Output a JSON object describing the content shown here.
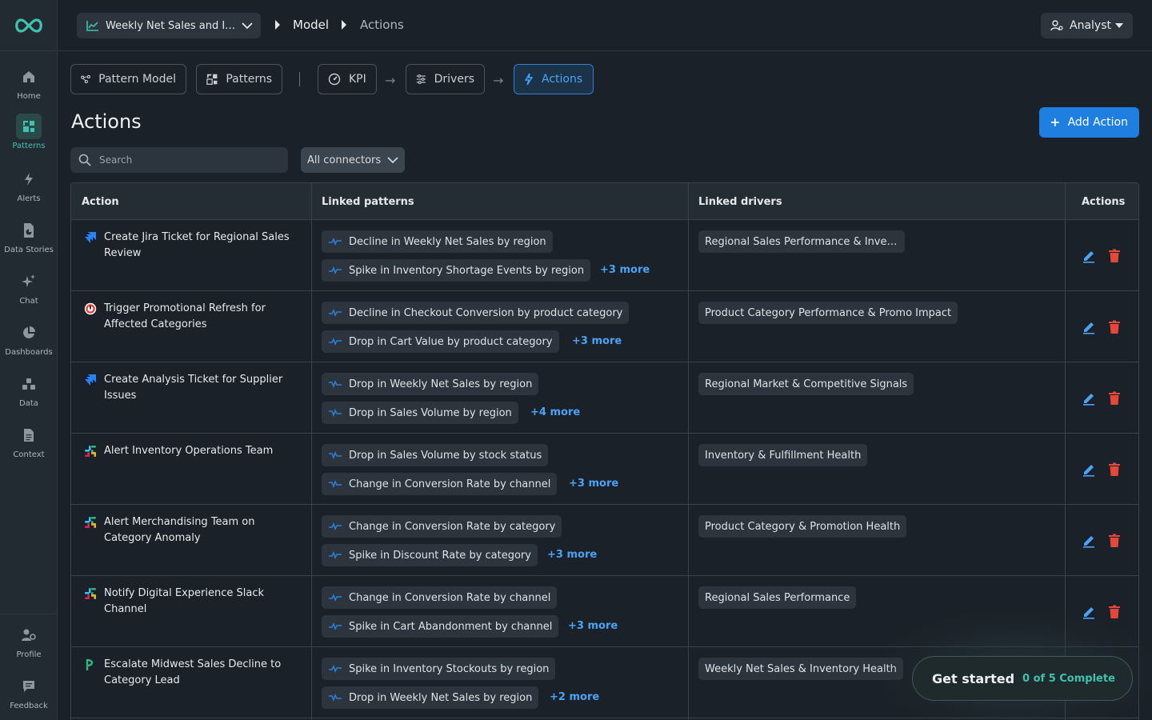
{
  "colors": {
    "accent": "#1f7fe0",
    "brand": "#3fc3b0",
    "danger": "#e5483b",
    "link": "#4aa3f5"
  },
  "sidebar": {
    "items": [
      {
        "label": "Home",
        "icon": "home-icon"
      },
      {
        "label": "Patterns",
        "icon": "patterns-icon"
      },
      {
        "label": "Alerts",
        "icon": "lightning-icon"
      },
      {
        "label": "Data Stories",
        "icon": "data-stories-icon"
      },
      {
        "label": "Chat",
        "icon": "sparkle-icon"
      },
      {
        "label": "Dashboards",
        "icon": "pie-chart-icon"
      },
      {
        "label": "Data",
        "icon": "data-icon"
      },
      {
        "label": "Context",
        "icon": "document-icon"
      }
    ],
    "bottom": [
      {
        "label": "Profile",
        "icon": "profile-icon"
      },
      {
        "label": "Feedback",
        "icon": "feedback-icon"
      }
    ]
  },
  "topbar": {
    "model": "Weekly Net Sales and Inventory Health",
    "breadcrumb": [
      "Model",
      "Actions"
    ],
    "role": "Analyst"
  },
  "pipeline": {
    "tabs": [
      "Pattern Model",
      "Patterns",
      "KPI",
      "Drivers",
      "Actions"
    ]
  },
  "page": {
    "title": "Actions",
    "add_button": "Add Action",
    "search_placeholder": "Search",
    "connector_filter": "All connectors"
  },
  "table": {
    "headers": [
      "Action",
      "Linked patterns",
      "Linked drivers",
      "Actions"
    ],
    "rows": [
      {
        "connector": "jira",
        "name": "Create Jira Ticket for Regional Sales Review",
        "patterns": [
          "Decline in Weekly Net Sales by region",
          "Spike in Inventory Shortage Events by region"
        ],
        "more": "+3 more",
        "driver": "Regional Sales Performance & Inventory Health"
      },
      {
        "connector": "pagerduty",
        "name": "Trigger Promotional Refresh for Affected Categories",
        "patterns": [
          "Decline in Checkout Conversion by product category",
          "Drop in Cart Value by product category"
        ],
        "more": "+3 more",
        "driver": "Product Category Performance & Promo Impact"
      },
      {
        "connector": "jira",
        "name": "Create Analysis Ticket for Supplier Issues",
        "patterns": [
          "Drop in Weekly Net Sales by region",
          "Drop in Sales Volume by region"
        ],
        "more": "+4 more",
        "driver": "Regional Market & Competitive Signals"
      },
      {
        "connector": "slack",
        "name": "Alert Inventory Operations Team",
        "patterns": [
          "Drop in Sales Volume by stock status",
          "Change in Conversion Rate by channel"
        ],
        "more": "+3 more",
        "driver": "Inventory & Fulfillment Health"
      },
      {
        "connector": "slack",
        "name": "Alert Merchandising Team on Category Anomaly",
        "patterns": [
          "Change in Conversion Rate by category",
          "Spike in Discount Rate by category"
        ],
        "more": "+3 more",
        "driver": "Product Category & Promotion Health"
      },
      {
        "connector": "slack",
        "name": "Notify Digital Experience Slack Channel",
        "patterns": [
          "Change in Conversion Rate by channel",
          "Spike in Cart Abandonment by channel"
        ],
        "more": "+3 more",
        "driver": "Regional Sales Performance"
      },
      {
        "connector": "pipedrive",
        "name": "Escalate Midwest Sales Decline to Category Lead",
        "patterns": [
          "Spike in Inventory Stockouts by region",
          "Drop in Weekly Net Sales by region"
        ],
        "more": "+2 more",
        "driver": "Weekly Net Sales & Inventory Health"
      }
    ]
  },
  "get_started": {
    "title": "Get started",
    "progress": "0 of 5 Complete"
  }
}
